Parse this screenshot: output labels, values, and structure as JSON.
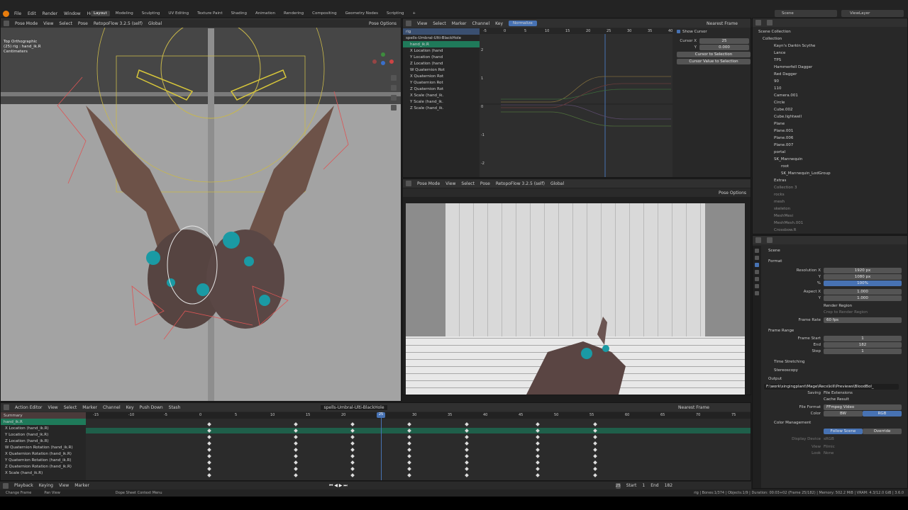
{
  "menu": [
    "File",
    "Edit",
    "Render",
    "Window",
    "Help"
  ],
  "workspaces": [
    "Layout",
    "Modeling",
    "Sculpting",
    "UV Editing",
    "Texture Paint",
    "Shading",
    "Animation",
    "Rendering",
    "Compositing",
    "Geometry Nodes",
    "Scripting"
  ],
  "active_workspace": "Layout",
  "scene": "Scene",
  "view_layer": "ViewLayer",
  "viewport_left": {
    "mode": "Pose Mode",
    "menus": [
      "View",
      "Select",
      "Pose"
    ],
    "addon": "RetopoFlow 3.2.5 (self)",
    "transform": "Global",
    "options": "Pose Options",
    "info_lines": [
      "Top Orthographic",
      "(25) rig : hand_ik.R",
      "Centimeters"
    ]
  },
  "graph_editor": {
    "menus": [
      "View",
      "Select",
      "Marker",
      "Channel",
      "Key"
    ],
    "normalize": "Normalize",
    "snap": "Nearest Frame",
    "ruler": [
      "-5",
      "0",
      "5",
      "10",
      "15",
      "20",
      "25",
      "30",
      "35",
      "40"
    ],
    "yvals": [
      "2",
      "1",
      "0",
      "-1",
      "-2"
    ],
    "channels": [
      "rig",
      "spells-Umbral-Ulti-BlackHole",
      "hand_ik.R",
      "X Location (hand",
      "Y Location (hand",
      "Z Location (hand",
      "W Quaternion Rot",
      "X Quaternion Rot",
      "Y Quaternion Rot",
      "Z Quaternion Rot",
      "X Scale (hand_ik.",
      "Y Scale (hand_ik.",
      "Z Scale (hand_ik."
    ],
    "show_cursor": "Show Cursor",
    "cursor_x_label": "Cursor X",
    "cursor_x": "25",
    "cursor_y_label": "Y",
    "cursor_y": "0.000",
    "btn1": "Cursor to Selection",
    "btn2": "Cursor Value to Selection"
  },
  "viewport_right": {
    "mode": "Pose Mode",
    "menus": [
      "View",
      "Select",
      "Pose"
    ],
    "addon": "RetopoFlow 3.2.5 (self)",
    "transform": "Global",
    "options": "Pose Options"
  },
  "outliner": {
    "items": [
      "Scene Collection",
      "Collection",
      "Kayn's Darkin Scythe",
      "Lance",
      "TPS",
      "Hammerfell Dagger",
      "Red Dagger",
      "90",
      "110",
      "Camera.001",
      "Circle",
      "Cube.002",
      "Cube.lightwell",
      "Plane",
      "Plane.001",
      "Plane.006",
      "Plane.007",
      "portal",
      "SK_Mannequin",
      "root",
      "SK_Mannequin_LodGroup",
      "Extras",
      "Collection 3",
      "rocks",
      "mesh",
      "skeleton",
      "MeshMesi",
      "MeshMesh.001",
      "Crossbow.R"
    ]
  },
  "properties": {
    "scene": "Scene",
    "format": "Format",
    "res_x_label": "Resolution X",
    "res_x": "1920 px",
    "res_y_label": "Y",
    "res_y": "1080 px",
    "pct": "100%",
    "aspect_x_label": "Aspect X",
    "aspect_x": "1.000",
    "aspect_y_label": "Y",
    "aspect_y": "1.000",
    "render_region": "Render Region",
    "crop": "Crop to Render Region",
    "frame_rate_label": "Frame Rate",
    "frame_rate": "60 fps",
    "frame_range": "Frame Range",
    "fs_label": "Frame Start",
    "fs": "1",
    "end_label": "End",
    "end": "182",
    "step_label": "Step",
    "step": "1",
    "time_stretching": "Time Stretching",
    "stereoscopy": "Stereoscopy",
    "output": "Output",
    "path": "F:\\work\\singingplant\\Mage\\Recs\\kill\\Previews\\BloodBol_",
    "saving": "Saving",
    "file_ext": "File Extensions",
    "cache": "Cache Result",
    "file_format_label": "File Format",
    "file_format": "FFmpeg Video",
    "color_label": "Color",
    "bw": "BW",
    "rgb": "RGB",
    "color_mgmt": "Color Management",
    "follow": "Follow Scene",
    "override": "Override",
    "display_device": "Display Device",
    "display_val": "sRGB",
    "view_label": "View",
    "view_val": "Filmic",
    "look_label": "Look",
    "look_val": "None"
  },
  "dopesheet": {
    "mode": "Action Editor",
    "menus": [
      "View",
      "Select",
      "Marker",
      "Channel",
      "Key"
    ],
    "push_down": "Push Down",
    "stash": "Stash",
    "action": "spells-Umbral-Ulti-BlackHole",
    "snap": "Nearest Frame",
    "ruler": [
      "-15",
      "-10",
      "-5",
      "0",
      "5",
      "10",
      "15",
      "20",
      "25",
      "30",
      "35",
      "40",
      "45",
      "50",
      "55",
      "60",
      "65",
      "70",
      "75"
    ],
    "channels": [
      "Summary",
      "hand_ik.R",
      "X Location (hand_ik.R)",
      "Y Location (hand_ik.R)",
      "Z Location (hand_ik.R)",
      "W Quaternion Rotation (hand_ik.R)",
      "X Quaternion Rotation (hand_ik.R)",
      "Y Quaternion Rotation (hand_ik.R)",
      "Z Quaternion Rotation (hand_ik.R)",
      "X Scale (hand_ik.R)"
    ]
  },
  "timeline": {
    "menus": [
      "Playback",
      "Keying",
      "View",
      "Marker"
    ],
    "frame": "25",
    "start_label": "Start",
    "start": "1",
    "end_label": "End",
    "end": "182"
  },
  "status": {
    "left": "Change Frame",
    "mid": "Pan View",
    "ctx": "Dope Sheet Context Menu",
    "right": "rig | Bones:1/374 | Objects:1/9 | Duration: 00:03+02 (Frame 25/182) | Memory: 502.2 MiB | VRAM: 4.3/12.0 GiB | 3.6.0"
  },
  "colors": {
    "accent": "#4772b3",
    "selected": "#1f7a5a",
    "bg": "#282828"
  }
}
